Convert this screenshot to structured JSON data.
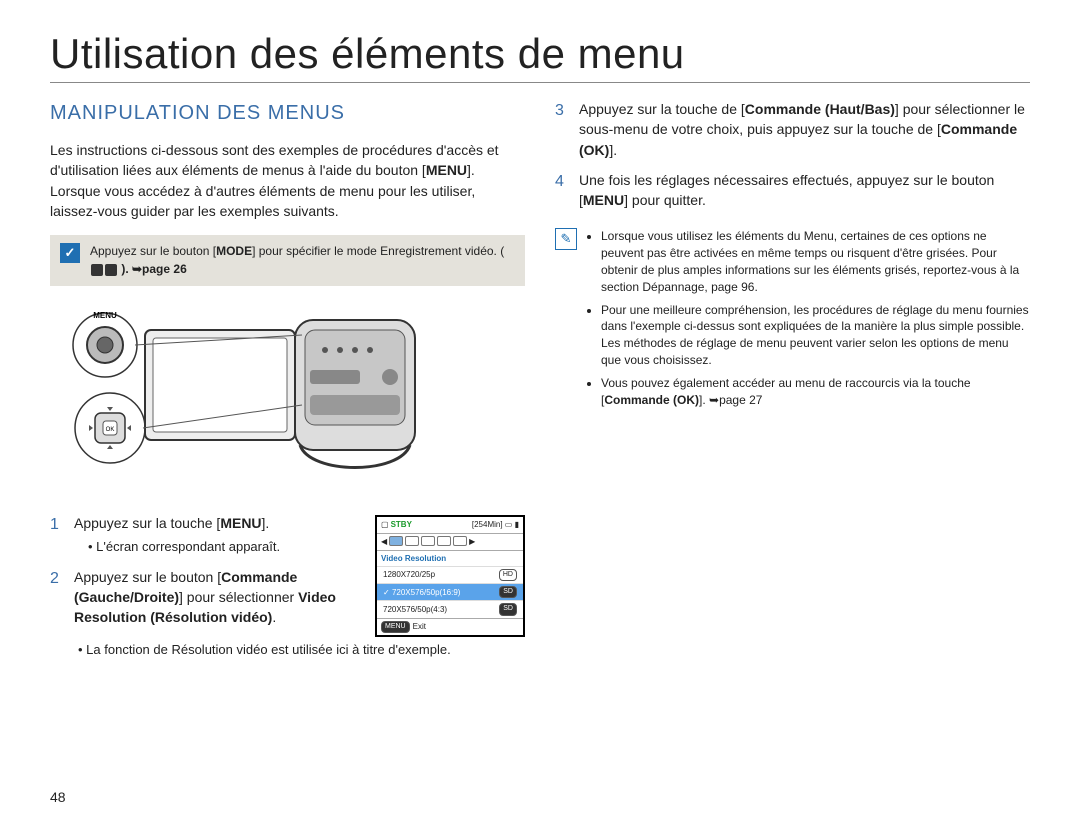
{
  "title": "Utilisation des éléments de menu",
  "subhead": "MANIPULATION DES MENUS",
  "intro": "Les instructions ci-dessous sont des exemples de procédures d'accès et d'utilisation liées aux éléments de menus à l'aide du bouton [MENU]. Lorsque vous accédez à d'autres éléments de menu pour les utiliser, laissez-vous guider par les exemples suivants.",
  "tip_pre": "Appuyez sur le bouton [",
  "tip_mode": "MODE",
  "tip_mid": "] pour spécifier le mode Enregistrement vidéo. ( ",
  "tip_pageref": " ). ➥page 26",
  "steps": {
    "s1": {
      "num": "1",
      "a": "Appuyez sur la touche [",
      "b": "MENU",
      "c": "].",
      "bullet": "L'écran correspondant apparaît."
    },
    "s2": {
      "num": "2",
      "a": "Appuyez sur le bouton [",
      "b": "Commande (Gauche/Droite)",
      "c": "] pour sélectionner ",
      "d": "Video Resolution (Résolution vidéo)",
      "e": ".",
      "bullet": "La fonction de Résolution vidéo est utilisée ici à titre d'exemple."
    },
    "s3": {
      "num": "3",
      "a": "Appuyez sur la touche de [",
      "b": "Commande (Haut/Bas)",
      "c": "] pour sélectionner le sous-menu de votre choix, puis appuyez sur la touche de [",
      "d": "Commande (OK)",
      "e": "]."
    },
    "s4": {
      "num": "4",
      "a": "Une fois les réglages nécessaires effectués, appuyez sur le bouton [",
      "b": "MENU",
      "c": "] pour quitter."
    }
  },
  "notes": [
    "Lorsque vous utilisez les éléments du Menu, certaines de ces options ne peuvent pas être activées en même temps ou risquent d'être grisées. Pour obtenir de plus amples informations sur les éléments grisés, reportez-vous à la section Dépannage, page 96.",
    "Pour une meilleure compréhension, les procédures de réglage du menu fournies dans l'exemple ci-dessus sont expliquées de la manière la plus simple possible. Les méthodes de réglage de menu peuvent varier selon les options de menu que vous choisissez."
  ],
  "note3_a": "Vous pouvez également accéder au menu de raccourcis via la touche [",
  "note3_b": "Commande (OK)",
  "note3_c": "]. ➥page 27",
  "menu_screen": {
    "stby": "STBY",
    "time": "[254Min]",
    "label": "Video Resolution",
    "item1": "1280X720/25p",
    "item1b": "HD",
    "item2": "720X576/50p(16:9)",
    "item2b": "SD",
    "item3": "720X576/50p(4:3)",
    "item3b": "SD",
    "exit_btn": "MENU",
    "exit": "Exit"
  },
  "camera_labels": {
    "menu": "MENU",
    "ok": "OK"
  },
  "page_number": "48"
}
